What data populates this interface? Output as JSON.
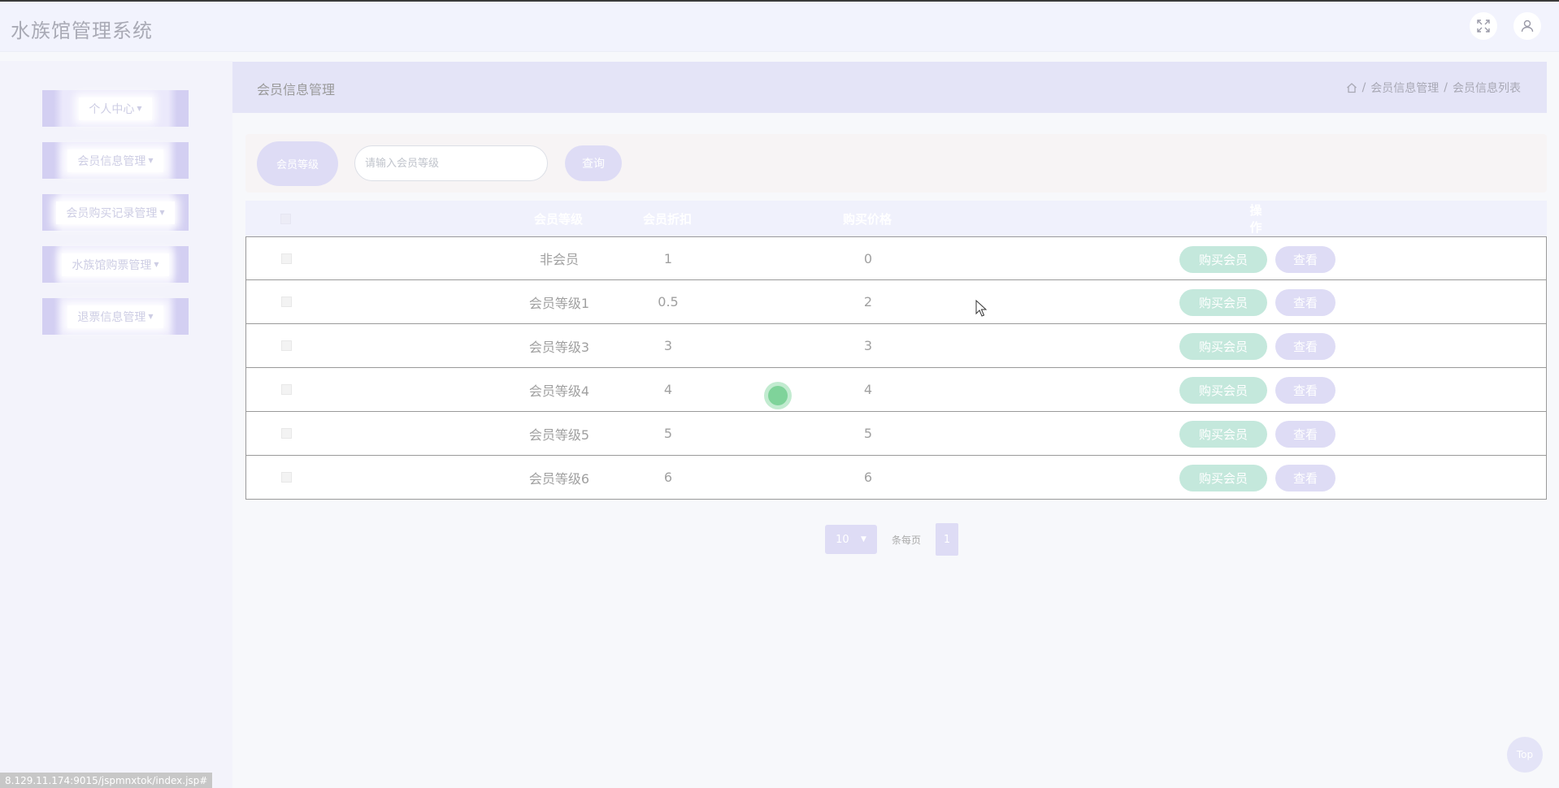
{
  "header": {
    "title": "水族馆管理系统"
  },
  "sidebar": {
    "items": [
      {
        "label": "个人中心"
      },
      {
        "label": "会员信息管理"
      },
      {
        "label": "会员购买记录管理"
      },
      {
        "label": "水族馆购票管理"
      },
      {
        "label": "退票信息管理"
      }
    ]
  },
  "breadcrumb": {
    "title": "会员信息管理",
    "items": [
      "会员信息管理",
      "会员信息列表"
    ],
    "separator": "/"
  },
  "search": {
    "label": "会员等级",
    "placeholder": "请输入会员等级",
    "button": "查询"
  },
  "table": {
    "headers": [
      "会员等级",
      "会员折扣",
      "购买价格",
      "操作"
    ],
    "buy_label": "购买会员",
    "view_label": "查看",
    "rows": [
      {
        "level": "非会员",
        "discount": "1",
        "price": "0"
      },
      {
        "level": "会员等级1",
        "discount": "0.5",
        "price": "2"
      },
      {
        "level": "会员等级3",
        "discount": "3",
        "price": "3"
      },
      {
        "level": "会员等级4",
        "discount": "4",
        "price": "4"
      },
      {
        "level": "会员等级5",
        "discount": "5",
        "price": "5"
      },
      {
        "level": "会员等级6",
        "discount": "6",
        "price": "6"
      }
    ]
  },
  "pagination": {
    "page_size": "10",
    "page_size_label": "条每页",
    "current_page": "1"
  },
  "status_bar": {
    "url": "8.129.11.174:9015/jspmnxtok/index.jsp#"
  },
  "back_to_top": {
    "label": "Top"
  },
  "colors": {
    "accent_lavender": "#dedcf5",
    "accent_mint": "#c4e8dc",
    "header_bg": "#f2f3fd"
  }
}
